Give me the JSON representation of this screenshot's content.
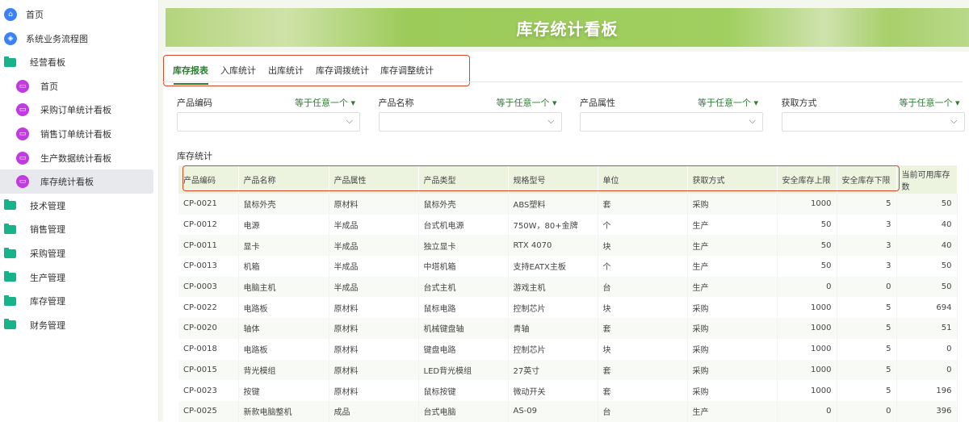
{
  "sidebar": {
    "items": [
      {
        "label": "首页",
        "icon": "home-icon",
        "type": "top"
      },
      {
        "label": "系统业务流程图",
        "icon": "box-icon",
        "type": "top"
      },
      {
        "label": "经营看板",
        "icon": "folder-icon",
        "type": "folder"
      },
      {
        "label": "首页",
        "icon": "dashboard-icon",
        "type": "sub"
      },
      {
        "label": "采购订单统计看板",
        "icon": "dashboard-icon",
        "type": "sub"
      },
      {
        "label": "销售订单统计看板",
        "icon": "dashboard-icon",
        "type": "sub"
      },
      {
        "label": "生产数据统计看板",
        "icon": "dashboard-icon",
        "type": "sub"
      },
      {
        "label": "库存统计看板",
        "icon": "dashboard-icon",
        "type": "sub",
        "selected": true
      },
      {
        "label": "技术管理",
        "icon": "folder-icon",
        "type": "folder"
      },
      {
        "label": "销售管理",
        "icon": "folder-icon",
        "type": "folder"
      },
      {
        "label": "采购管理",
        "icon": "folder-icon",
        "type": "folder"
      },
      {
        "label": "生产管理",
        "icon": "folder-icon",
        "type": "folder"
      },
      {
        "label": "库存管理",
        "icon": "folder-icon",
        "type": "folder"
      },
      {
        "label": "财务管理",
        "icon": "folder-icon",
        "type": "folder"
      }
    ]
  },
  "banner": {
    "title": "库存统计看板"
  },
  "tabs": [
    "库存报表",
    "入库统计",
    "出库统计",
    "库存调拨统计",
    "库存调整统计"
  ],
  "filters": [
    {
      "label": "产品编码",
      "operator": "等于任意一个 ▾"
    },
    {
      "label": "产品名称",
      "operator": "等于任意一个 ▾"
    },
    {
      "label": "产品属性",
      "operator": "等于任意一个 ▾"
    },
    {
      "label": "获取方式",
      "operator": "等于任意一个 ▾"
    }
  ],
  "section": {
    "title": "库存统计"
  },
  "table": {
    "columns": [
      "产品编码",
      "产品名称",
      "产品属性",
      "产品类型",
      "规格型号",
      "单位",
      "获取方式",
      "安全库存上限",
      "安全库存下限",
      "当前可用库存数"
    ],
    "rows": [
      [
        "CP-0021",
        "鼠标外壳",
        "原材料",
        "鼠标外壳",
        "ABS塑料",
        "套",
        "采购",
        "1000",
        "5",
        "50"
      ],
      [
        "CP-0012",
        "电源",
        "半成品",
        "台式机电源",
        "750W，80+金牌",
        "个",
        "生产",
        "50",
        "3",
        "40"
      ],
      [
        "CP-0011",
        "显卡",
        "半成品",
        "独立显卡",
        "RTX 4070",
        "块",
        "生产",
        "50",
        "3",
        "40"
      ],
      [
        "CP-0013",
        "机箱",
        "半成品",
        "中塔机箱",
        "支持EATX主板",
        "个",
        "生产",
        "50",
        "3",
        "50"
      ],
      [
        "CP-0003",
        "电脑主机",
        "半成品",
        "台式主机",
        "游戏主机",
        "台",
        "生产",
        "0",
        "0",
        "50"
      ],
      [
        "CP-0022",
        "电路板",
        "原材料",
        "鼠标电路",
        "控制芯片",
        "块",
        "采购",
        "1000",
        "5",
        "694"
      ],
      [
        "CP-0020",
        "轴体",
        "原材料",
        "机械键盘轴",
        "青轴",
        "套",
        "采购",
        "1000",
        "5",
        "51"
      ],
      [
        "CP-0018",
        "电路板",
        "原材料",
        "键盘电路",
        "控制芯片",
        "块",
        "采购",
        "1000",
        "5",
        "0"
      ],
      [
        "CP-0015",
        "背光模组",
        "原材料",
        "LED背光模组",
        "27英寸",
        "套",
        "采购",
        "1000",
        "5",
        "0"
      ],
      [
        "CP-0023",
        "按键",
        "原材料",
        "鼠标按键",
        "微动开关",
        "套",
        "采购",
        "1000",
        "5",
        "196"
      ],
      [
        "CP-0025",
        "新款电脑整机",
        "成品",
        "台式电脑",
        "AS-09",
        "台",
        "生产",
        "0",
        "0",
        "396"
      ]
    ]
  }
}
